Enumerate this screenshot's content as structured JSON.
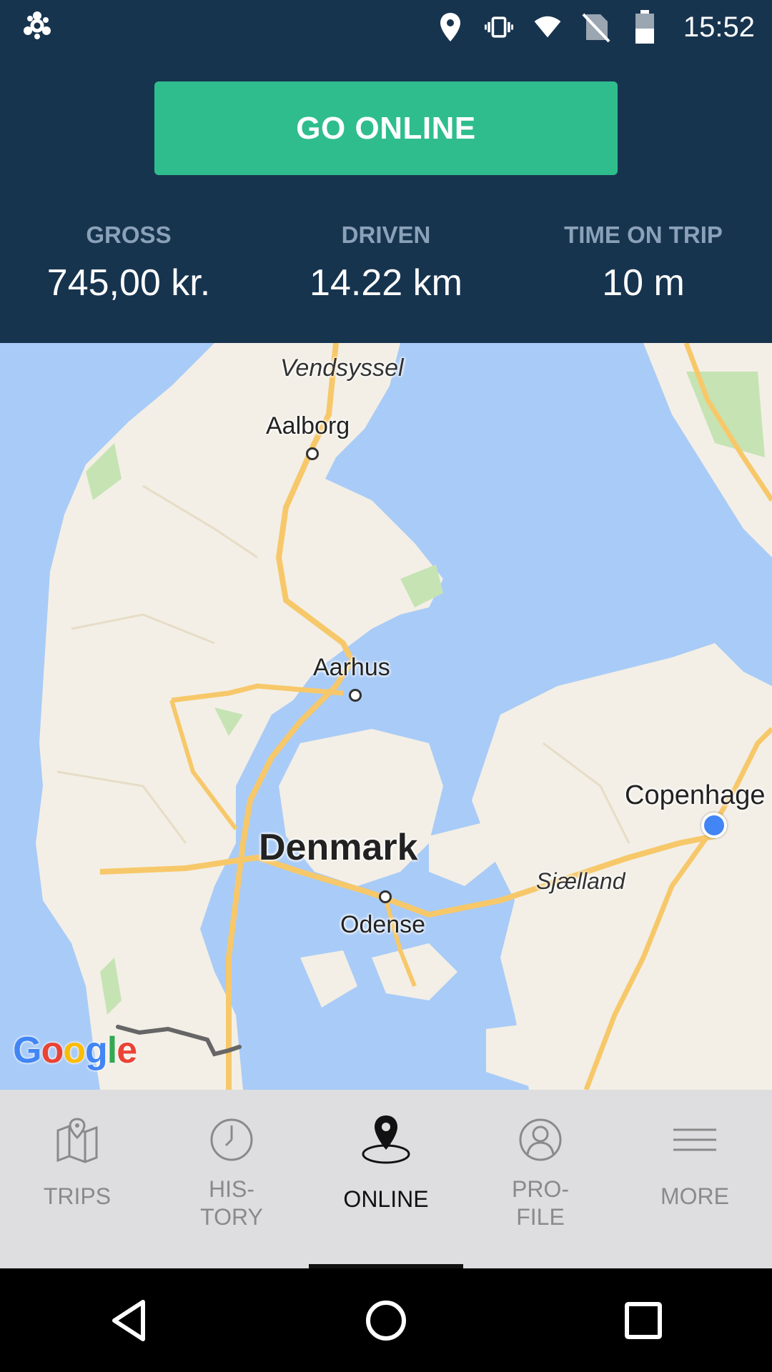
{
  "status_bar": {
    "time": "15:52",
    "icons": [
      "app-settings-icon",
      "location-icon",
      "vibrate-icon",
      "wifi-icon",
      "no-sim-icon",
      "battery-icon"
    ]
  },
  "header": {
    "go_online_label": "GO ONLINE",
    "stats": [
      {
        "label": "GROSS",
        "value": "745,00 kr."
      },
      {
        "label": "DRIVEN",
        "value": "14.22 km"
      },
      {
        "label": "TIME ON TRIP",
        "value": "10 m"
      }
    ]
  },
  "map": {
    "labels": {
      "vendsyssel": "Vendsyssel",
      "aalborg": "Aalborg",
      "aarhus": "Aarhus",
      "denmark": "Denmark",
      "odense": "Odense",
      "sjaelland": "Sjælland",
      "copenhagen": "Copenhage"
    },
    "attribution": [
      "G",
      "o",
      "o",
      "g",
      "l",
      "e"
    ],
    "colors": {
      "water": "#a9cbf7",
      "land": "#f3efe6",
      "road": "#f7c86a",
      "park": "#c6e3b4",
      "location": "#4285f4"
    }
  },
  "bottom_nav": {
    "items": [
      {
        "label": "TRIPS",
        "icon": "map-icon"
      },
      {
        "label": "HIS-\nTORY",
        "icon": "clock-icon"
      },
      {
        "label": "ONLINE",
        "icon": "location-pin-icon"
      },
      {
        "label": "PRO-\nFILE",
        "icon": "profile-icon"
      },
      {
        "label": "MORE",
        "icon": "menu-icon"
      }
    ],
    "active": "ONLINE"
  },
  "system_nav": {
    "icons": [
      "back-icon",
      "home-icon",
      "recents-icon"
    ]
  },
  "colors": {
    "header_bg": "#17344f",
    "button_bg": "#2fbd8e",
    "stat_label": "#8aa1b8",
    "nav_bg": "#dedee0"
  }
}
